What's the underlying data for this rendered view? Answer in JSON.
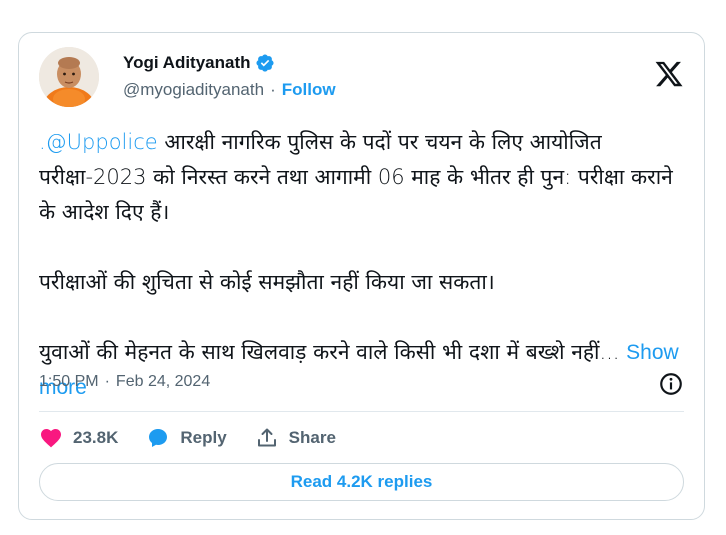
{
  "author": {
    "name": "Yogi Adityanath",
    "handle": "@myogiadityanath",
    "separator": "·",
    "follow_label": "Follow",
    "verified_color": "#1d9bf0",
    "avatar": "profile-photo"
  },
  "tweet": {
    "mention": ".@Uppolice",
    "paragraphs": [
      " आरक्षी नागरिक पुलिस के पदों पर चयन के लिए आयोजित परीक्षा-2023 को निरस्त करने तथा आगामी 06 माह के भीतर ही पुन: परीक्षा कराने के आदेश दिए हैं।",
      "परीक्षाओं की शुचिता से कोई समझौता नहीं किया जा सकता।",
      "युवाओं की मेहनत के साथ खिलवाड़ करने वाले किसी भी दशा में बख्शे नहीं... "
    ],
    "show_more": "Show more"
  },
  "meta": {
    "time": "1:50 PM",
    "separator": "·",
    "date": "Feb 24, 2024"
  },
  "actions": {
    "likes": "23.8K",
    "reply_label": "Reply",
    "share_label": "Share"
  },
  "read_replies_label": "Read 4.2K replies",
  "colors": {
    "accent": "#1d9bf0",
    "like": "#f91880",
    "text": "#0f1419",
    "muted": "#536471",
    "border": "#cfd9de"
  },
  "icons": [
    "x-logo-icon",
    "verified-badge-icon",
    "info-icon",
    "heart-icon",
    "reply-bubble-icon",
    "share-icon"
  ]
}
